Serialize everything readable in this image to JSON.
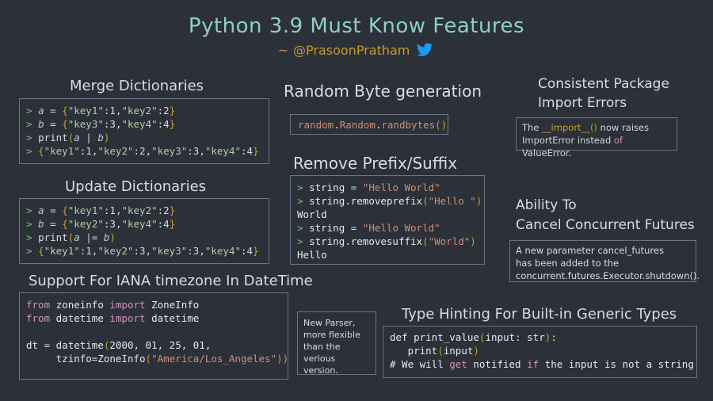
{
  "header": {
    "title": "Python 3.9 Must Know Features",
    "byline_prefix": "~",
    "handle": "@PrasoonPratham",
    "twitter_icon": "twitter-bird-icon",
    "title_color": "#8fd0c0",
    "handle_color": "#c79a2e"
  },
  "sections": {
    "merge_dictionaries": {
      "heading": "Merge Dictionaries",
      "code_lines": [
        "> a = {\"key1\":1,\"key2\":2}",
        "> b = {\"key3\":3,\"key4\":4}",
        "> print(a | b)",
        "> {\"key1\":1,\"key2\":2,\"key3\":3,\"key4\":4}"
      ]
    },
    "update_dictionaries": {
      "heading": "Update Dictionaries",
      "code_lines": [
        "> a = {\"key1\":1,\"key2\":2}",
        "> b = {\"key2\":3,\"key4\":4}",
        "> print(a |= b)",
        "> {\"key1\":1,\"key2\":3,\"key3\":3,\"key4\":4}"
      ]
    },
    "iana_timezone": {
      "heading": "Support For IANA timezone In DateTime",
      "code_lines": [
        "from zoneinfo import ZoneInfo",
        "from datetime import datetime",
        "",
        "dt = datetime(2000, 01, 25, 01,",
        "     tzinfo=ZoneInfo(\"America/Los_Angeles\"))"
      ]
    },
    "random_bytes": {
      "heading": "Random Byte generation",
      "code": "random.Random.randbytes()"
    },
    "remove_prefix_suffix": {
      "heading": "Remove Prefix/Suffix",
      "code_lines": [
        "> string = \"Hello World\"",
        "> string.removeprefix(\"Hello \")",
        "World",
        "> string = \"Hello World\"",
        "> string.removesuffix(\"World\")",
        "Hello"
      ]
    },
    "import_errors": {
      "heading_line1": "Consistent Package",
      "heading_line2": "Import Errors",
      "body_line1": "The __import__() now raises",
      "body_line2": "ImportError instead of ValueError."
    },
    "cancel_futures": {
      "heading_line1": "Ability To",
      "heading_line2": "Cancel Concurrent Futures",
      "body_line1": "A new parameter cancel_futures",
      "body_line2": "has been added to the",
      "body_line3": "concurrent.futures.Executor.shutdown()."
    },
    "new_parser": {
      "body_line1": "New Parser,",
      "body_line2": " more flexible",
      "body_line3": "than the",
      "body_line4": " verious version."
    },
    "type_hinting": {
      "heading": "Type Hinting For Built-in Generic Types",
      "code_lines": [
        "def print_value(input: str):",
        "   print(input)",
        "# We will get notified if the input is not a string"
      ]
    }
  }
}
